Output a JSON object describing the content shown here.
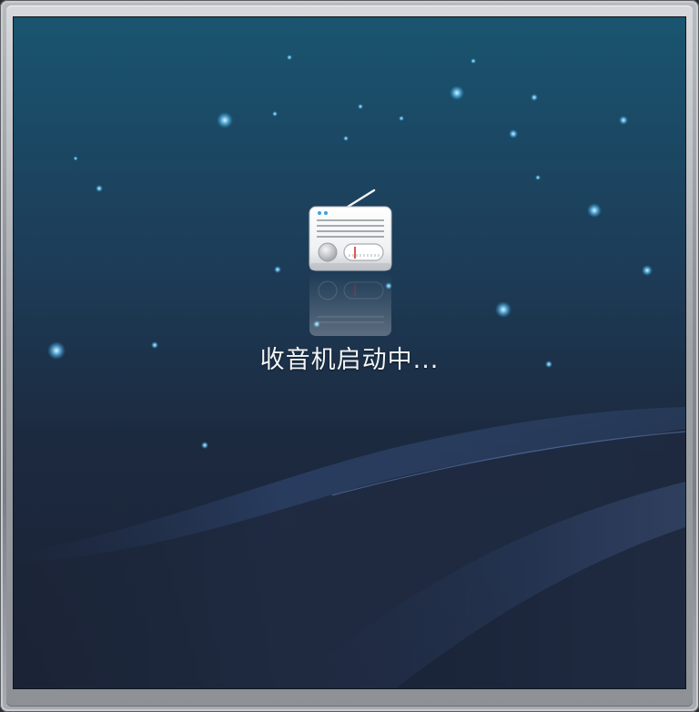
{
  "app": {
    "loading_text": "收音机启动中...",
    "icon": "radio-icon"
  },
  "colors": {
    "screen_top": "#1a5570",
    "screen_bottom": "#1a2133",
    "star": "#7fd4ff",
    "wave": "#3f5a8c",
    "tuner_needle": "#d9322b"
  }
}
